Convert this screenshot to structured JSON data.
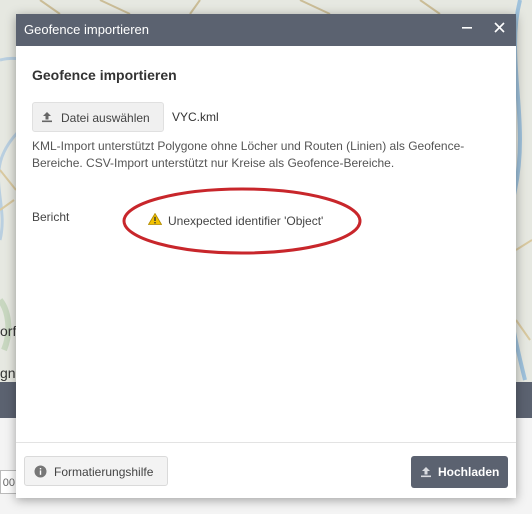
{
  "background": {
    "map_text_1": "orf",
    "map_text_2": "gn",
    "field_fragment": "00"
  },
  "dialog": {
    "window_title": "Geofence importieren",
    "heading": "Geofence importieren",
    "file_button_label": "Datei auswählen",
    "file_name": "VYC.kml",
    "info_text": "KML-Import unterstützt Polygone ohne Löcher und Routen (Linien) als Geofence-Bereiche. CSV-Import unterstützt nur Kreise als Geofence-Bereiche.",
    "report_label": "Bericht",
    "warning_message": "Unexpected identifier 'Object'",
    "help_button_label": "Formatierungshilfe",
    "upload_button_label": "Hochladen"
  },
  "icons": {
    "minimize": "minimize-icon",
    "close": "close-icon",
    "upload": "upload-icon",
    "warning": "warning-icon",
    "info": "info-icon"
  },
  "colors": {
    "titlebar": "#5b6270",
    "annotation_ellipse": "#c8262b",
    "warning_yellow": "#f2c200"
  }
}
